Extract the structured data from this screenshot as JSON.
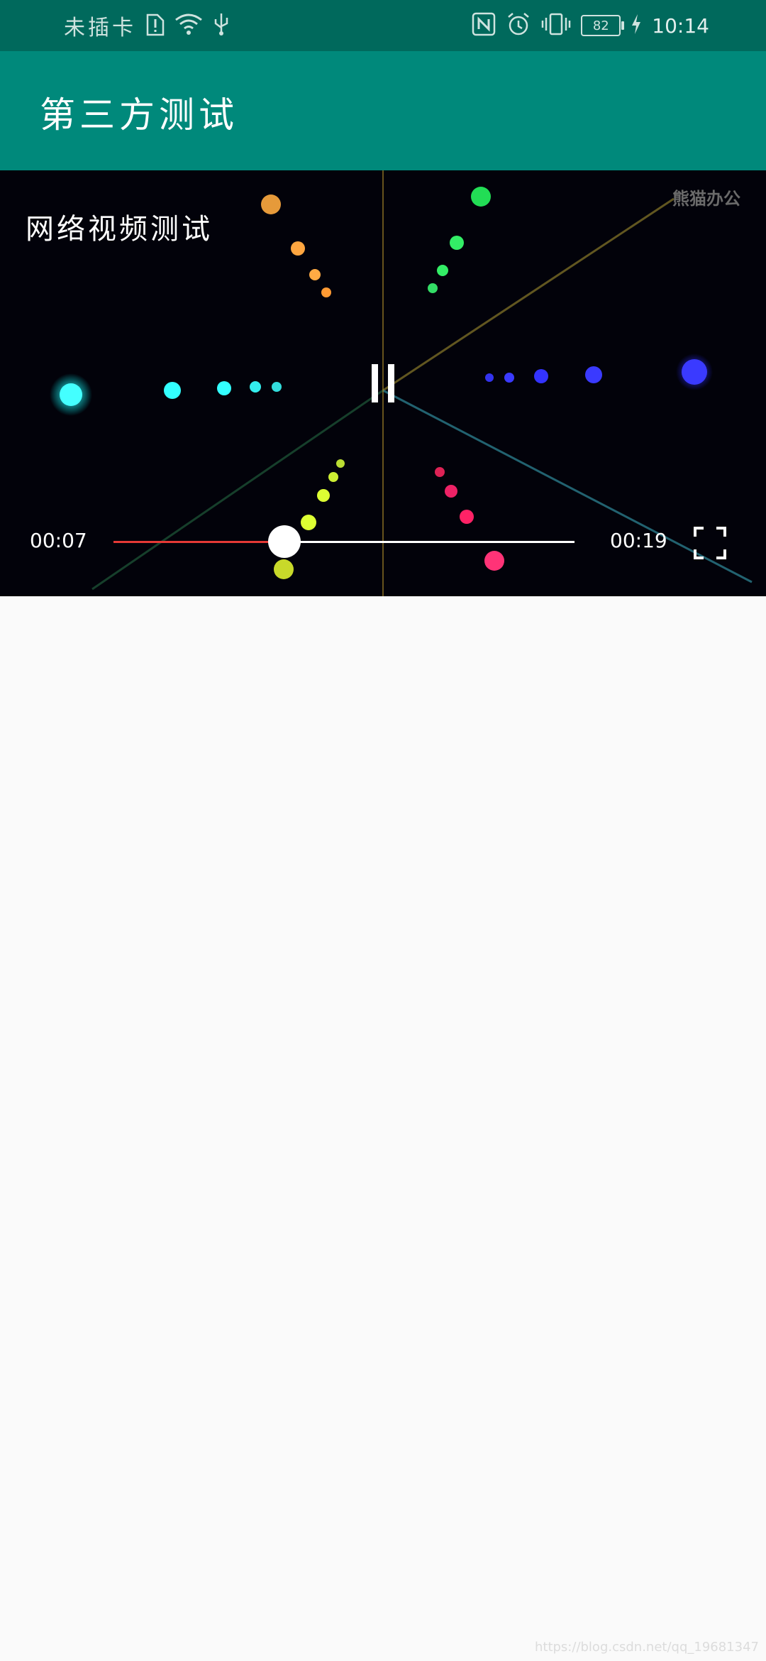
{
  "status_bar": {
    "carrier": "未插卡",
    "icons": [
      "sim-alert-icon",
      "wifi-icon",
      "usb-icon",
      "nfc-icon",
      "alarm-icon",
      "vibrate-icon",
      "battery-icon",
      "charging-icon"
    ],
    "battery_level": "82",
    "time": "10:14"
  },
  "app_bar": {
    "title": "第三方测试"
  },
  "video_player": {
    "title": "网络视频测试",
    "watermark": "熊猫办公",
    "current_time": "00:07",
    "total_time": "00:19",
    "progress_fraction": 0.37,
    "progress_color": "#e53935",
    "control_icons": [
      "pause-icon",
      "fullscreen-icon"
    ]
  },
  "footer": {
    "watermark": "https://blog.csdn.net/qq_19681347"
  },
  "colors": {
    "status_bar": "#00695c",
    "app_bar": "#00897b",
    "page_background": "#fafafa"
  }
}
